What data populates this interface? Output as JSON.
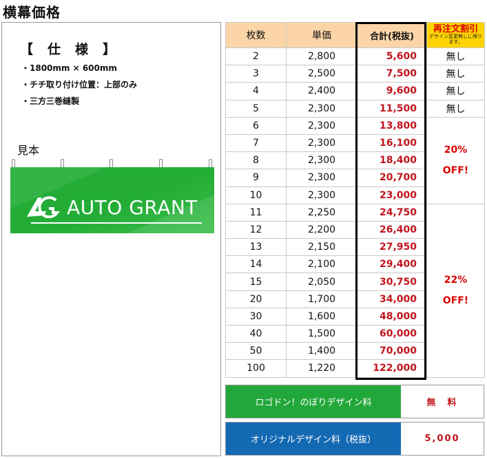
{
  "page_title": "横幕価格",
  "spec": {
    "heading": "【　仕　様　】",
    "items": [
      "・1800mm × 600mm",
      "・チチ取り付け位置：上部のみ",
      "・三方三巻縫製"
    ]
  },
  "sample": {
    "label": "見本",
    "logo_text": "AUTO GRANT",
    "banner_color": "#23ad37"
  },
  "table": {
    "headers": {
      "qty": "枚数",
      "unit": "単価",
      "total": "合計(税抜)",
      "discount_title": "再注文割引",
      "discount_note": "デザイン変更無しに限ります。"
    },
    "rows": [
      {
        "qty": "2",
        "unit": "2,800",
        "total": "5,600",
        "discount": "無し"
      },
      {
        "qty": "3",
        "unit": "2,500",
        "total": "7,500",
        "discount": "無し"
      },
      {
        "qty": "4",
        "unit": "2,400",
        "total": "9,600",
        "discount": "無し"
      },
      {
        "qty": "5",
        "unit": "2,300",
        "total": "11,500",
        "discount": "無し"
      },
      {
        "qty": "6",
        "unit": "2,300",
        "total": "13,800"
      },
      {
        "qty": "7",
        "unit": "2,300",
        "total": "16,100"
      },
      {
        "qty": "8",
        "unit": "2,300",
        "total": "18,400"
      },
      {
        "qty": "9",
        "unit": "2,300",
        "total": "20,700"
      },
      {
        "qty": "10",
        "unit": "2,300",
        "total": "23,000"
      },
      {
        "qty": "11",
        "unit": "2,250",
        "total": "24,750"
      },
      {
        "qty": "12",
        "unit": "2,200",
        "total": "26,400"
      },
      {
        "qty": "13",
        "unit": "2,150",
        "total": "27,950"
      },
      {
        "qty": "14",
        "unit": "2,100",
        "total": "29,400"
      },
      {
        "qty": "15",
        "unit": "2,050",
        "total": "30,750"
      },
      {
        "qty": "20",
        "unit": "1,700",
        "total": "34,000"
      },
      {
        "qty": "30",
        "unit": "1,600",
        "total": "48,000"
      },
      {
        "qty": "40",
        "unit": "1,500",
        "total": "60,000"
      },
      {
        "qty": "50",
        "unit": "1,400",
        "total": "70,000"
      },
      {
        "qty": "100",
        "unit": "1,220",
        "total": "122,000"
      }
    ],
    "discount_groups": [
      {
        "line1": "20%",
        "line2": "OFF!",
        "rows": 5
      },
      {
        "line1": "22%",
        "line2": "OFF!",
        "rows": 10
      }
    ]
  },
  "fees": [
    {
      "label": "ロゴドン！のぼりデザイン料",
      "value": "無　料",
      "color": "#22a83a"
    },
    {
      "label": "オリジナルデザイン料（税抜）",
      "value": "5,000",
      "color": "#1469b3"
    }
  ]
}
